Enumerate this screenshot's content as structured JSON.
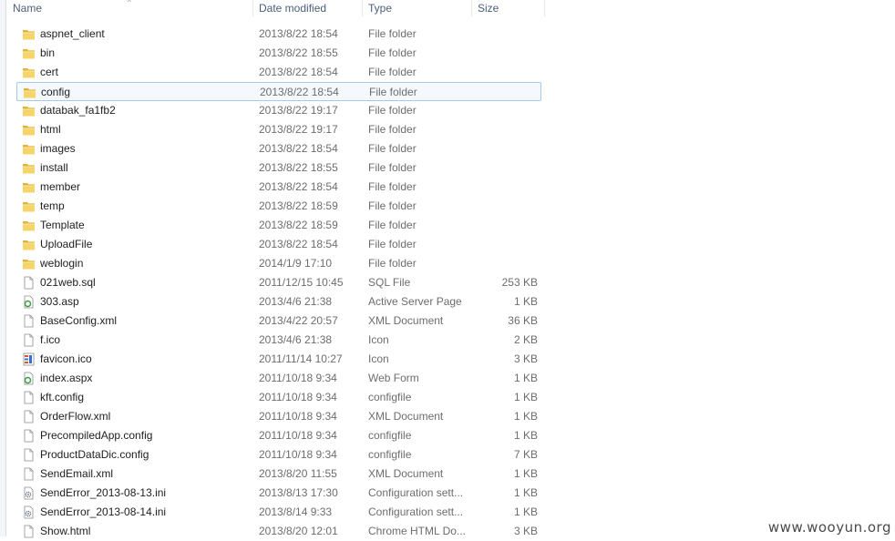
{
  "header": {
    "name": "Name",
    "date": "Date modified",
    "type": "Type",
    "size": "Size"
  },
  "rows": [
    {
      "name": "aspnet_client",
      "date": "2013/8/22 18:54",
      "type": "File folder",
      "size": "",
      "icon": "folder-icon"
    },
    {
      "name": "bin",
      "date": "2013/8/22 18:55",
      "type": "File folder",
      "size": "",
      "icon": "folder-icon"
    },
    {
      "name": "cert",
      "date": "2013/8/22 18:54",
      "type": "File folder",
      "size": "",
      "icon": "folder-icon"
    },
    {
      "name": "config",
      "date": "2013/8/22 18:54",
      "type": "File folder",
      "size": "",
      "icon": "folder-icon",
      "selected": true
    },
    {
      "name": "databak_fa1fb2",
      "date": "2013/8/22 19:17",
      "type": "File folder",
      "size": "",
      "icon": "folder-icon"
    },
    {
      "name": "html",
      "date": "2013/8/22 19:17",
      "type": "File folder",
      "size": "",
      "icon": "folder-icon"
    },
    {
      "name": "images",
      "date": "2013/8/22 18:54",
      "type": "File folder",
      "size": "",
      "icon": "folder-icon"
    },
    {
      "name": "install",
      "date": "2013/8/22 18:55",
      "type": "File folder",
      "size": "",
      "icon": "folder-icon"
    },
    {
      "name": "member",
      "date": "2013/8/22 18:54",
      "type": "File folder",
      "size": "",
      "icon": "folder-icon"
    },
    {
      "name": "temp",
      "date": "2013/8/22 18:59",
      "type": "File folder",
      "size": "",
      "icon": "folder-icon"
    },
    {
      "name": "Template",
      "date": "2013/8/22 18:59",
      "type": "File folder",
      "size": "",
      "icon": "folder-icon"
    },
    {
      "name": "UploadFile",
      "date": "2013/8/22 18:54",
      "type": "File folder",
      "size": "",
      "icon": "folder-icon"
    },
    {
      "name": "weblogin",
      "date": "2014/1/9 17:10",
      "type": "File folder",
      "size": "",
      "icon": "folder-icon"
    },
    {
      "name": "021web.sql",
      "date": "2011/12/15 10:45",
      "type": "SQL File",
      "size": "253 KB",
      "icon": "file-icon"
    },
    {
      "name": "303.asp",
      "date": "2013/4/6 21:38",
      "type": "Active Server Page",
      "size": "1 KB",
      "icon": "asp-file-icon"
    },
    {
      "name": "BaseConfig.xml",
      "date": "2013/4/22 20:57",
      "type": "XML Document",
      "size": "36 KB",
      "icon": "file-icon"
    },
    {
      "name": "f.ico",
      "date": "2013/4/6 21:38",
      "type": "Icon",
      "size": "2 KB",
      "icon": "file-icon"
    },
    {
      "name": "favicon.ico",
      "date": "2011/11/14 10:27",
      "type": "Icon",
      "size": "3 KB",
      "icon": "favicon-file-icon"
    },
    {
      "name": "index.aspx",
      "date": "2011/10/18 9:34",
      "type": "Web Form",
      "size": "1 KB",
      "icon": "asp-file-icon"
    },
    {
      "name": "kft.config",
      "date": "2011/10/18 9:34",
      "type": "configfile",
      "size": "1 KB",
      "icon": "file-icon"
    },
    {
      "name": "OrderFlow.xml",
      "date": "2011/10/18 9:34",
      "type": "XML Document",
      "size": "1 KB",
      "icon": "file-icon"
    },
    {
      "name": "PrecompiledApp.config",
      "date": "2011/10/18 9:34",
      "type": "configfile",
      "size": "1 KB",
      "icon": "file-icon"
    },
    {
      "name": "ProductDataDic.config",
      "date": "2011/10/18 9:34",
      "type": "configfile",
      "size": "7 KB",
      "icon": "file-icon"
    },
    {
      "name": "SendEmail.xml",
      "date": "2013/8/20 11:55",
      "type": "XML Document",
      "size": "1 KB",
      "icon": "file-icon"
    },
    {
      "name": "SendError_2013-08-13.ini",
      "date": "2013/8/13 17:30",
      "type": "Configuration sett...",
      "size": "1 KB",
      "icon": "ini-file-icon"
    },
    {
      "name": "SendError_2013-08-14.ini",
      "date": "2013/8/14 9:33",
      "type": "Configuration sett...",
      "size": "1 KB",
      "icon": "ini-file-icon"
    },
    {
      "name": "Show.html",
      "date": "2013/8/20 12:01",
      "type": "Chrome HTML Do...",
      "size": "3 KB",
      "icon": "file-icon"
    }
  ],
  "watermark": "www.wooyun.org"
}
